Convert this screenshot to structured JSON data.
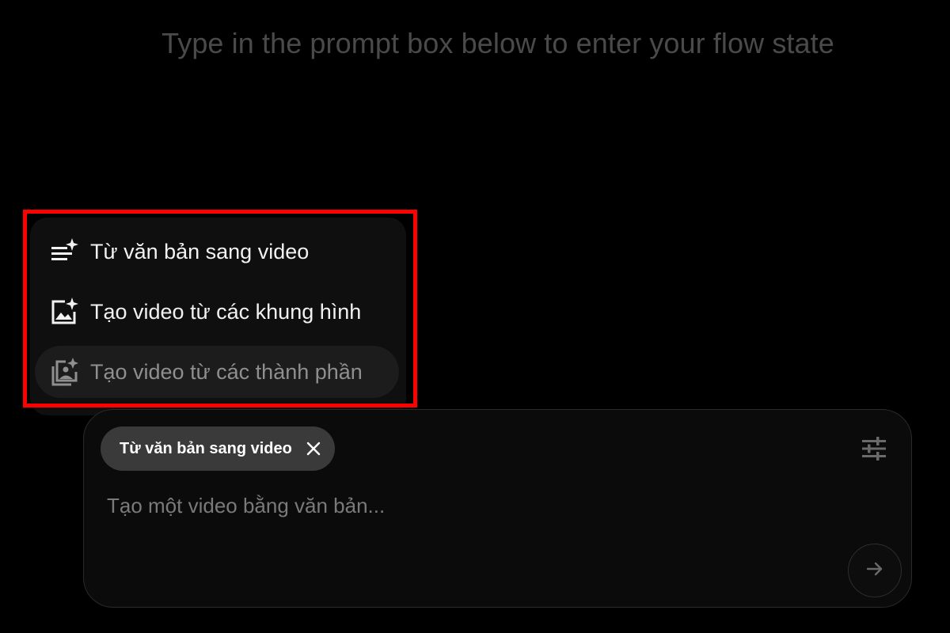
{
  "headline": "Type in the prompt box below to enter your flow state",
  "menu": {
    "items": [
      {
        "label": "Từ văn bản sang video",
        "icon": "text-sparkle-icon"
      },
      {
        "label": "Tạo video từ các khung hình",
        "icon": "image-sparkle-icon"
      },
      {
        "label": "Tạo video từ các thành phần",
        "icon": "image-stack-sparkle-icon"
      }
    ]
  },
  "prompt": {
    "chip_label": "Từ văn bản sang video",
    "placeholder": "Tạo một video bằng văn bản...",
    "value": ""
  },
  "colors": {
    "background": "#000000",
    "highlight": "#ff0000",
    "chip": "#3a3a3a"
  }
}
